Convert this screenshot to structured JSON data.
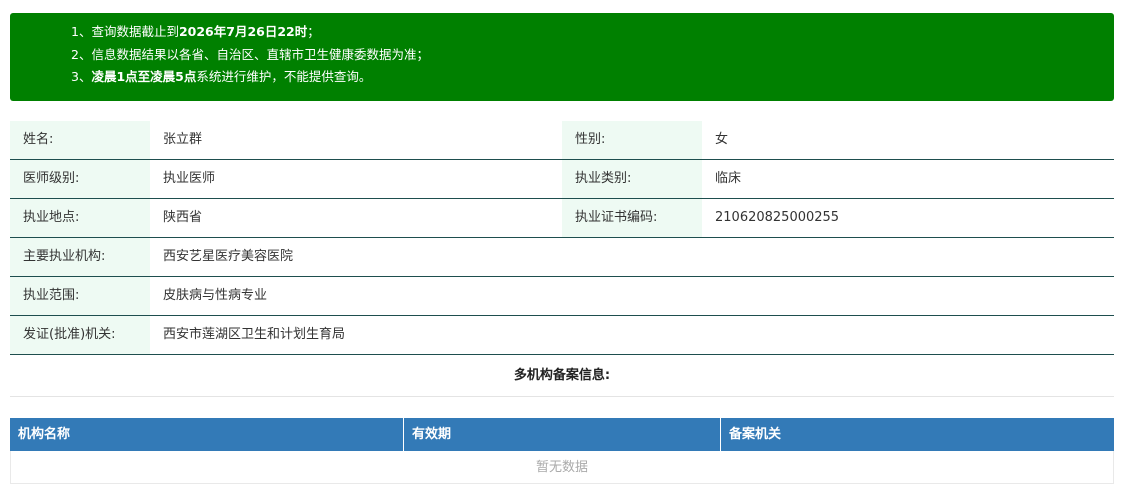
{
  "notice": {
    "line1_prefix": "1、查询数据截止到",
    "line1_bold": "2026年7月26日22时",
    "line1_suffix": "；",
    "line2": "2、信息数据结果以各省、自治区、直辖市卫生健康委数据为准；",
    "line3_prefix": "3、",
    "line3_bold": "凌晨1点至凌晨5点",
    "line3_suffix": "系统进行维护，不能提供查询。"
  },
  "info": {
    "name_label": "姓名:",
    "name_value": "张立群",
    "gender_label": "性别:",
    "gender_value": "女",
    "level_label": "医师级别:",
    "level_value": "执业医师",
    "category_label": "执业类别:",
    "category_value": "临床",
    "location_label": "执业地点:",
    "location_value": "陕西省",
    "cert_label": "执业证书编码:",
    "cert_value": "210620825000255",
    "institution_label": "主要执业机构:",
    "institution_value": "西安艺星医疗美容医院",
    "scope_label": "执业范围:",
    "scope_value": "皮肤病与性病专业",
    "issuer_label": "发证(批准)机关:",
    "issuer_value": "西安市莲湖区卫生和计划生育局"
  },
  "multi": {
    "title": "多机构备案信息:",
    "columns": [
      "机构名称",
      "有效期",
      "备案机关"
    ],
    "empty_text": "暂无数据"
  },
  "colors": {
    "notice_bg": "#008000",
    "label_bg": "#eefaf3",
    "table_header_bg": "#337ab7"
  }
}
